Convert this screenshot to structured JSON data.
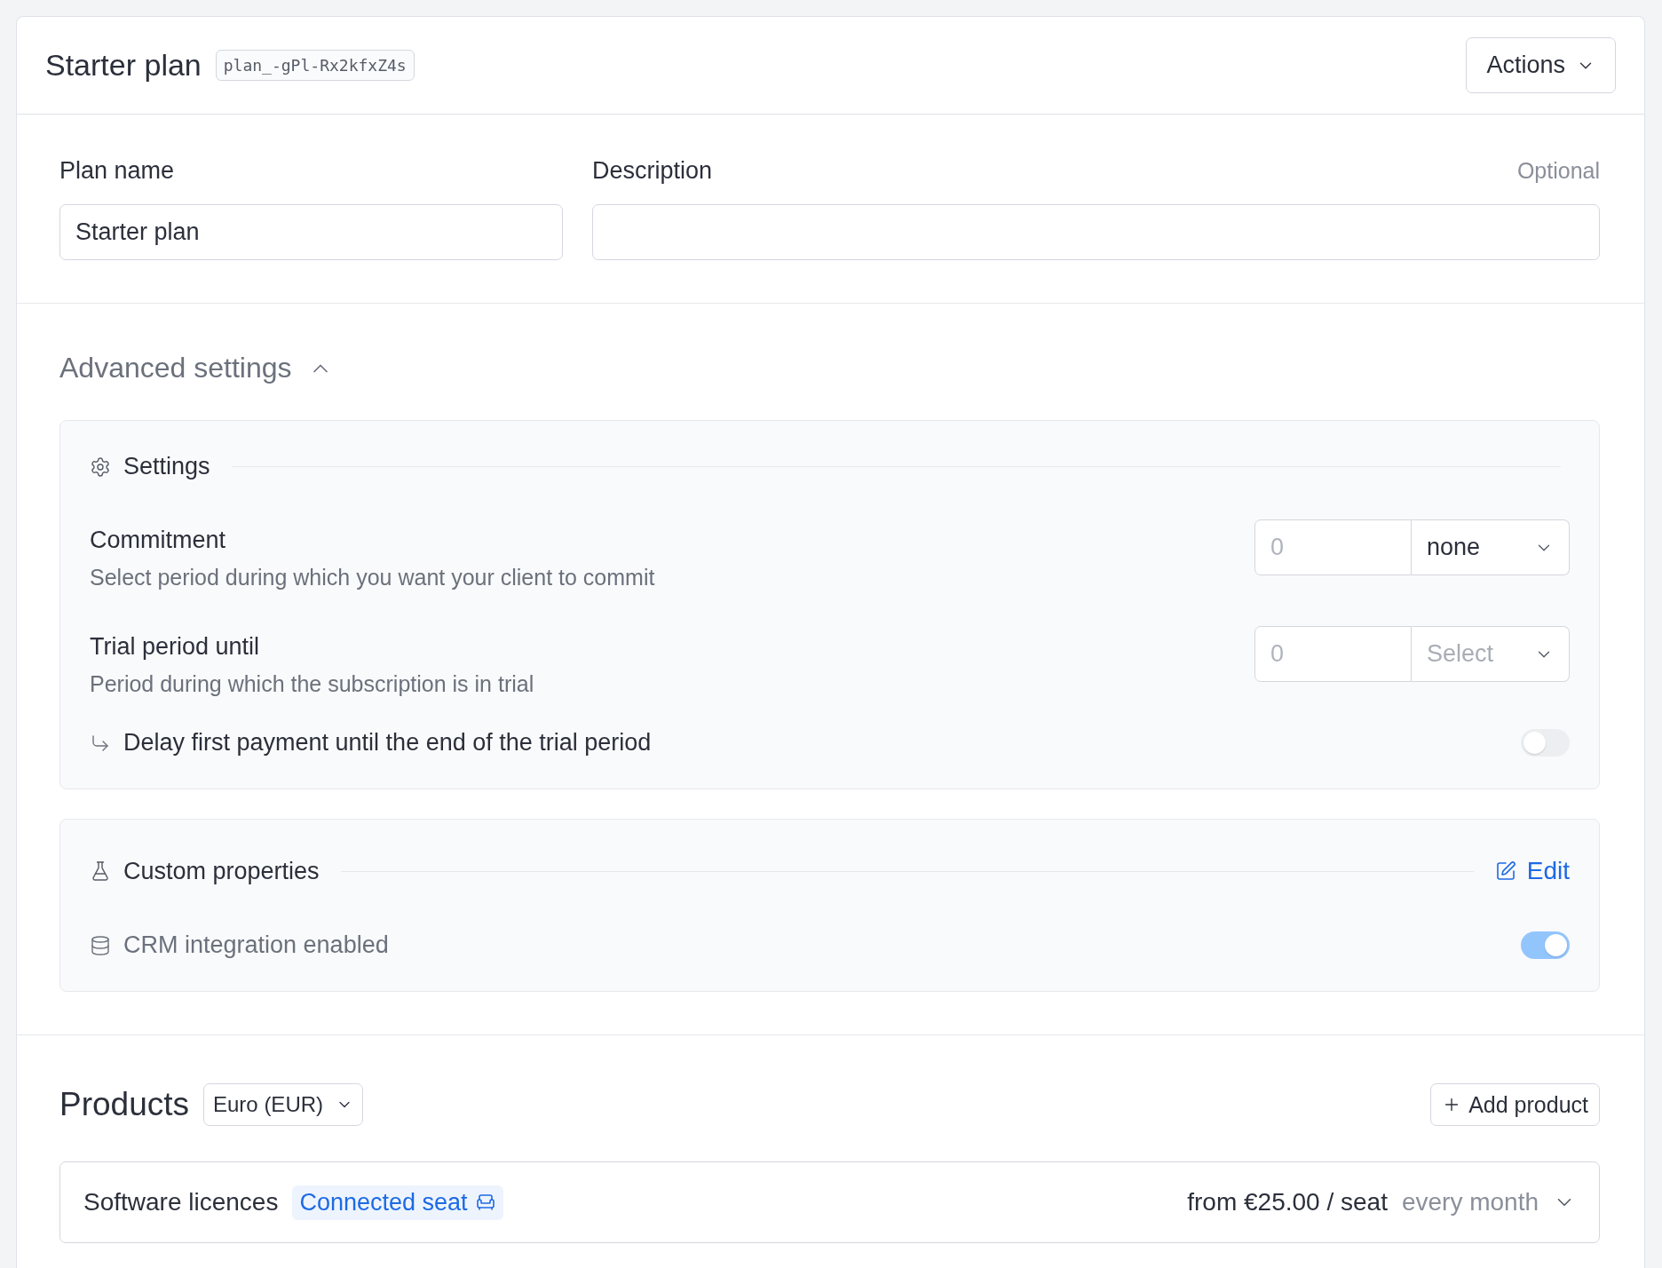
{
  "header": {
    "title": "Starter plan",
    "plan_id": "plan_-gPl-Rx2kfxZ4s",
    "actions_button": "Actions"
  },
  "form": {
    "plan_name": {
      "label": "Plan name",
      "value": "Starter plan"
    },
    "description": {
      "label": "Description",
      "hint": "Optional"
    }
  },
  "advanced": {
    "title": "Advanced settings",
    "expanded": true,
    "settings": {
      "title": "Settings",
      "rows": [
        {
          "title": "Commitment",
          "description": "Select period during which you want your client to commit",
          "number_placeholder": "0",
          "period": "none",
          "period_is_placeholder": false
        },
        {
          "title": "Trial period until",
          "description": "Period during which the subscription is in trial",
          "number_placeholder": "0",
          "period": "Select",
          "period_is_placeholder": true
        }
      ],
      "delay": {
        "label": "Delay first payment until the end of the trial period",
        "on": false
      }
    },
    "custom_properties": {
      "title": "Custom properties",
      "edit_link": "Edit",
      "crm": {
        "label": "CRM integration enabled",
        "on": true
      }
    }
  },
  "products": {
    "title": "Products",
    "currency": "Euro (EUR)",
    "add_button": "Add product",
    "items": [
      {
        "name": "Software licences",
        "tag": "Connected seat",
        "price": "from €25.00 / seat",
        "interval": "every month",
        "expanded": false
      }
    ]
  }
}
